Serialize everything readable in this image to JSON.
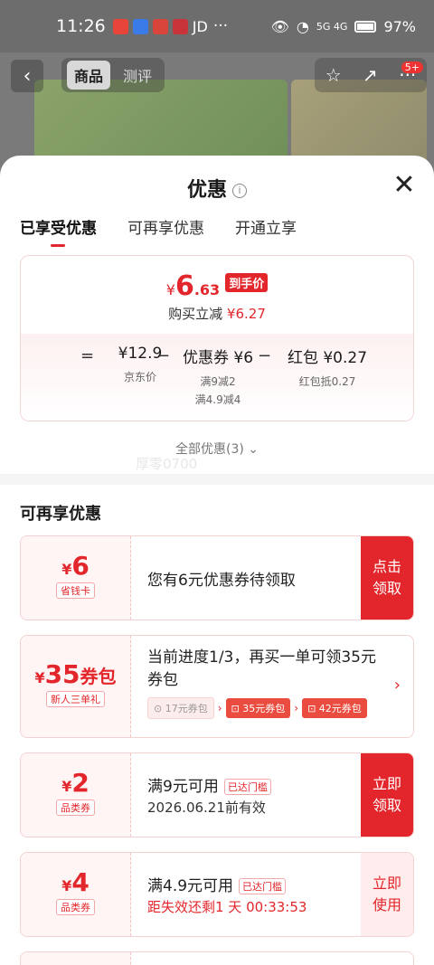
{
  "statusbar": {
    "time": "11:26",
    "app_label": "JD",
    "more": "···",
    "network": "5G 4G",
    "battery": "97%"
  },
  "topbar": {
    "tab_goods": "商品",
    "tab_review": "测评",
    "msg_badge": "5+"
  },
  "sheet": {
    "title": "优惠",
    "tabs": [
      "已享受优惠",
      "可再享优惠",
      "开通立享"
    ],
    "summary": {
      "price_yen": "¥",
      "price_int": "6",
      "price_dec": ".63",
      "price_tag": "到手价",
      "reduce_label": "购买立减",
      "reduce_value": "¥6.27",
      "eq": "=",
      "base_value": "¥12.9",
      "base_label": "京东价",
      "minus1": "−",
      "coupon_value": "优惠券 ¥6",
      "coupon_sub1": "满9减2",
      "coupon_sub2": "满4.9减4",
      "minus2": "−",
      "redpack_value": "红包 ¥0.27",
      "redpack_sub": "红包抵0.27"
    },
    "all_offers": "全部优惠(3)",
    "watermark": "厚零0700",
    "section_title": "可再享优惠",
    "cards": [
      {
        "yen": "¥",
        "amount": "6",
        "unit": "",
        "label": "省钱卡",
        "text": "您有6元优惠券待领取",
        "cta": "点击领取"
      },
      {
        "yen": "¥",
        "amount": "35",
        "unit": "券包",
        "label": "新人三单礼",
        "text": "当前进度1/3，再买一单可领35元券包",
        "steps": [
          "17元券包",
          "35元券包",
          "42元券包"
        ]
      },
      {
        "yen": "¥",
        "amount": "2",
        "unit": "",
        "label": "品类券",
        "text": "满9元可用",
        "chip": "已达门槛",
        "sub": "2026.06.21前有效",
        "cta": "立即领取"
      },
      {
        "yen": "¥",
        "amount": "4",
        "unit": "",
        "label": "品类券",
        "text": "满4.9元可用",
        "chip": "已达门槛",
        "sub": "距失效还剩1 天 00:33:53",
        "cta": "立即使用"
      }
    ]
  },
  "colors": {
    "accent": "#e3262b",
    "card_bg": "#fff5f5"
  }
}
